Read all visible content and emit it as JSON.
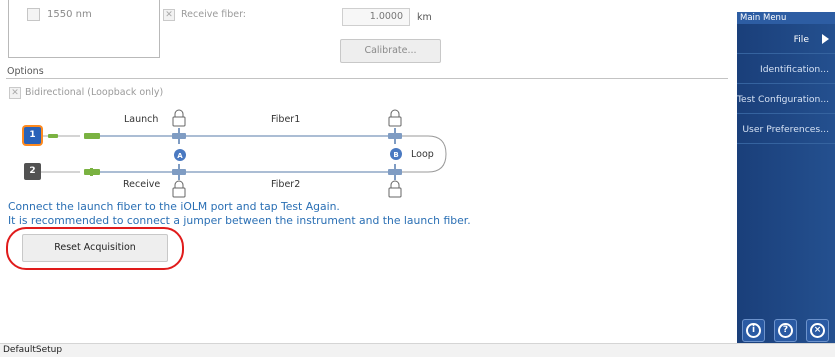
{
  "wavelength": {
    "label": "1550 nm"
  },
  "receive_fiber": {
    "label": "Receive fiber:",
    "value": "1.0000",
    "unit": "km"
  },
  "calibrate_label": "Calibrate...",
  "options_label": "Options",
  "bidirectional_label": "Bidirectional (Loopback only)",
  "diagram": {
    "launch_label": "Launch",
    "receive_label": "Receive",
    "fiber1_label": "Fiber1",
    "fiber2_label": "Fiber2",
    "loop_label": "Loop",
    "port1": "1",
    "port2": "2",
    "marker_a": "A",
    "marker_b": "B"
  },
  "messages": {
    "line1": "Connect the launch fiber to the iOLM port and tap Test Again.",
    "line2": "It is recommended to connect a jumper between the instrument and the launch fiber."
  },
  "reset_button_label": "Reset Acquisition",
  "sidebar": {
    "header": "Main Menu",
    "items": [
      "File",
      "Identification...",
      "Test Configuration...",
      "User Preferences..."
    ]
  },
  "status_bar": {
    "text": "DefaultSetup"
  },
  "colors": {
    "accent": "#2a6fb4",
    "sidebar": "#1f4a8a",
    "highlight": "#e01b1b",
    "port_active": "#ff8a1e"
  }
}
